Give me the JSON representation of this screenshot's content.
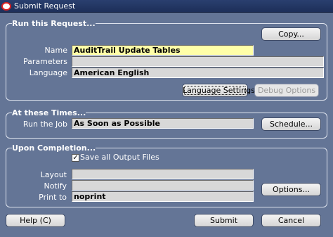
{
  "window": {
    "title": "Submit Request"
  },
  "run_request": {
    "heading": "Run this Request...",
    "copy_button": "Copy...",
    "name_label": "Name",
    "name_value": "AuditTrail Update Tables",
    "parameters_label": "Parameters",
    "parameters_value": "",
    "language_label": "Language",
    "language_value": "American English",
    "language_settings_button": "Language Settings...",
    "debug_options_button": "Debug Options"
  },
  "schedule": {
    "heading": "At these Times...",
    "run_label": "Run the Job",
    "run_value": "As Soon as Possible",
    "schedule_button": "Schedule..."
  },
  "completion": {
    "heading": "Upon Completion...",
    "save_output_label": "Save all Output Files",
    "save_output_checked": true,
    "layout_label": "Layout",
    "layout_value": "",
    "notify_label": "Notify",
    "notify_value": "",
    "print_label": "Print to",
    "print_value": "noprint",
    "options_button": "Options..."
  },
  "footer": {
    "help_button": "Help (C)",
    "submit_button": "Submit",
    "cancel_button": "Cancel"
  }
}
